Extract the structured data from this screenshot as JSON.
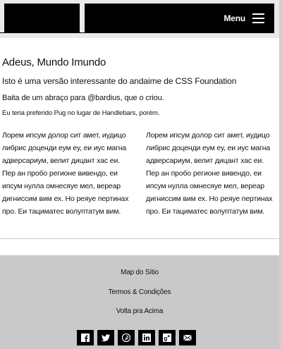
{
  "header": {
    "menu_label": "Menu"
  },
  "main": {
    "title": "Adeus, Mundo Imundo",
    "lead": "Isto é uma versão interessante do andaime de CSS Foundation",
    "credit": "Baita de um abraço para @bardius, que o criou.",
    "note": "Eu teria preferido Pug no lugar de Handlebars, porém.",
    "columns": [
      "Лорем ипсум долор сит амет, иудицо либрис доценди еум еу, еи иус магна адверсариум, велит дицант хас еи. Пер ан пробо регионе вивендо, еи ипсум нулла омнесяуе мел, вереар дигниссим вим ех. Но реяуе пертинах про. Еи тациматес волуптатум вим.",
      "Лорем ипсум долор сит амет, иудицо либрис доценди еум еу, еи иус магна адверсариум, велит дицант хас еи. Пер ан пробо регионе вивендо, еи ипсум нулла омнесяуе мел, вереар дигниссим вим ех. Но реяуе пертинах про. Еи тациматес волуптатум вим."
    ]
  },
  "footer": {
    "links": [
      "Map do Sítio",
      "Termos & Condições",
      "Volta pra Acima"
    ],
    "social_icons": [
      "facebook-icon",
      "twitter-icon",
      "pinterest-icon",
      "linkedin-icon",
      "google-plus-icon",
      "email-icon"
    ]
  }
}
